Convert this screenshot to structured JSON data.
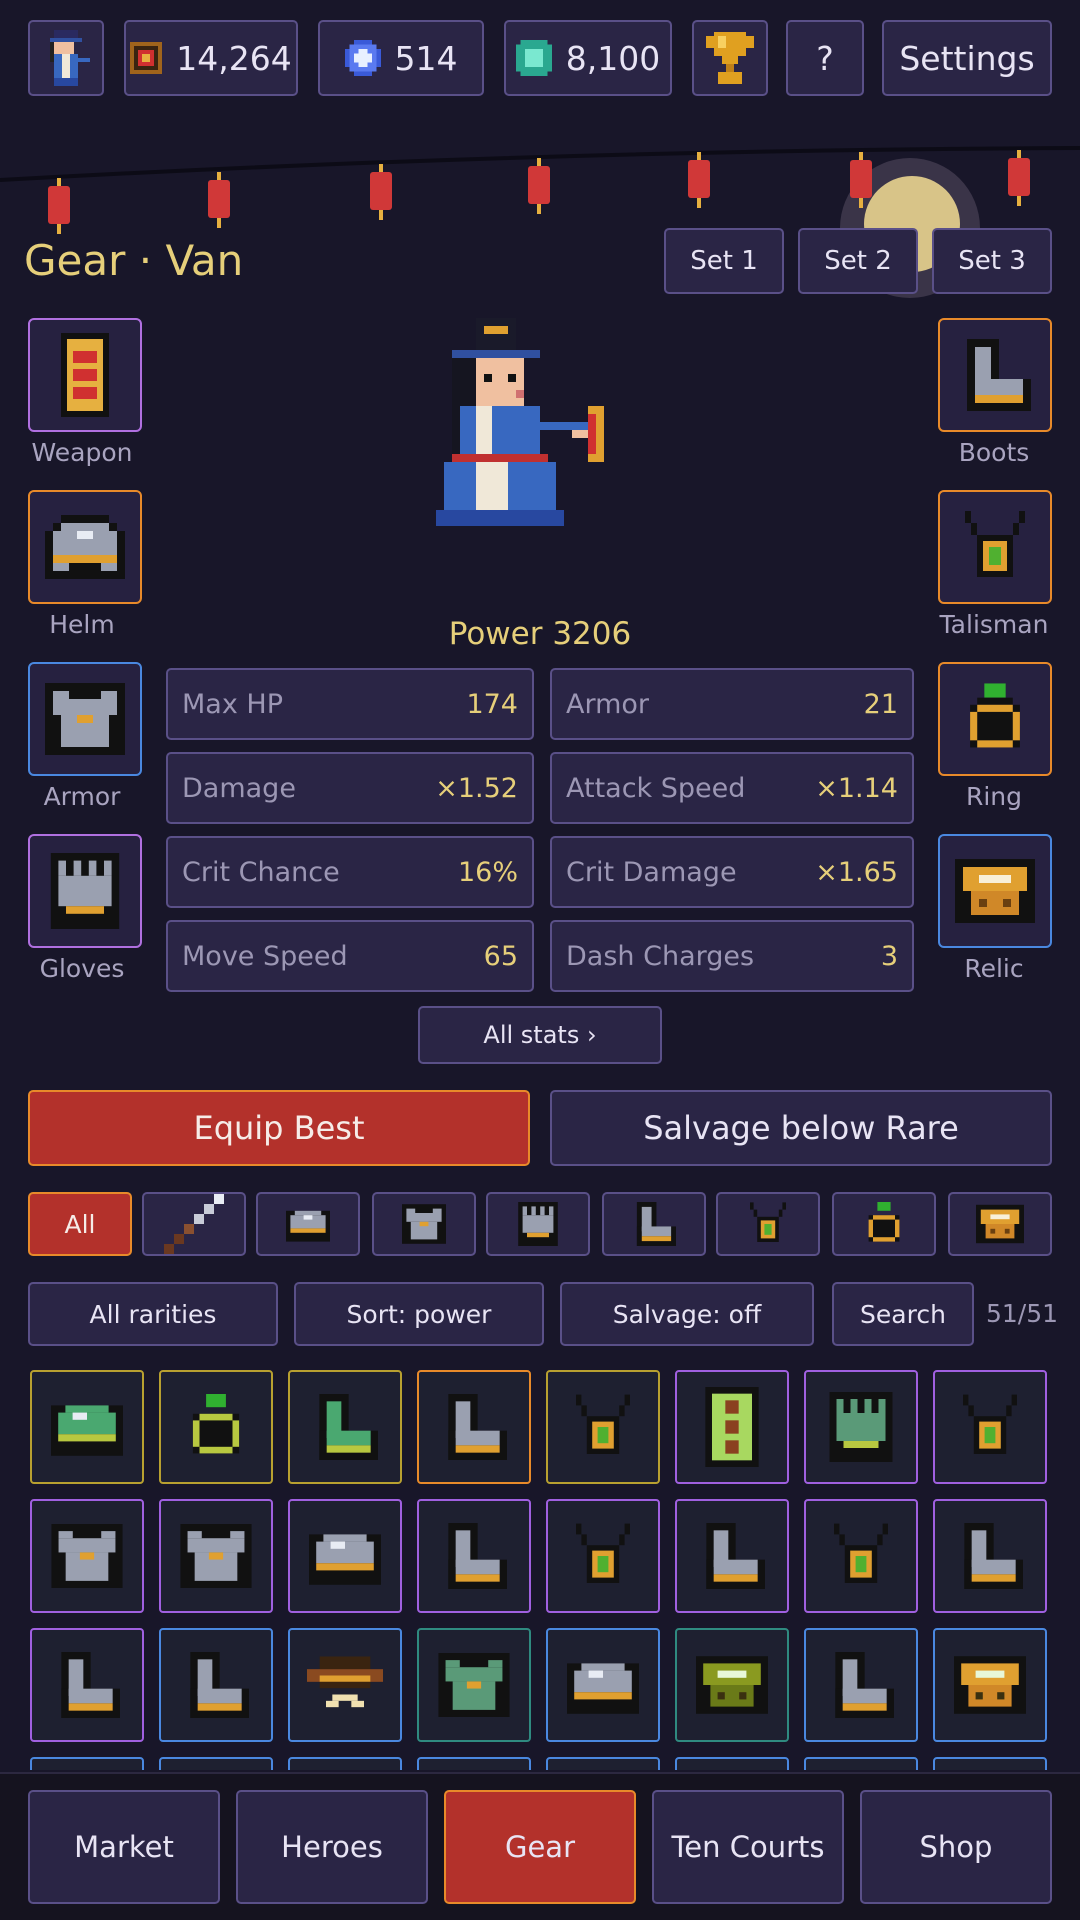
{
  "topbar": {
    "gold": "14,264",
    "essence": "514",
    "gems": "8,100",
    "help_label": "?",
    "settings_label": "Settings"
  },
  "header": {
    "title": "Gear · Van",
    "sets": [
      "Set 1",
      "Set 2",
      "Set 3"
    ]
  },
  "slots": {
    "left": [
      {
        "label": "Weapon",
        "icon": "scroll-icon",
        "rarity": "epic"
      },
      {
        "label": "Helm",
        "icon": "helm-icon",
        "rarity": "legendary"
      },
      {
        "label": "Armor",
        "icon": "armor-icon",
        "rarity": "rare"
      },
      {
        "label": "Gloves",
        "icon": "gloves-icon",
        "rarity": "epic"
      }
    ],
    "right": [
      {
        "label": "Boots",
        "icon": "boots-icon",
        "rarity": "legendary"
      },
      {
        "label": "Talisman",
        "icon": "talisman-icon",
        "rarity": "legendary"
      },
      {
        "label": "Ring",
        "icon": "ring-icon",
        "rarity": "legendary"
      },
      {
        "label": "Relic",
        "icon": "relic-icon",
        "rarity": "rare"
      }
    ]
  },
  "power_label": "Power 3206",
  "stats": [
    {
      "name": "Max HP",
      "value": "174"
    },
    {
      "name": "Armor",
      "value": "21"
    },
    {
      "name": "Damage",
      "value": "×1.52"
    },
    {
      "name": "Attack Speed",
      "value": "×1.14"
    },
    {
      "name": "Crit Chance",
      "value": "16%"
    },
    {
      "name": "Crit Damage",
      "value": "×1.65"
    },
    {
      "name": "Move Speed",
      "value": "65"
    },
    {
      "name": "Dash Charges",
      "value": "3"
    }
  ],
  "all_stats_label": "All stats ›",
  "actions": {
    "equip_best": "Equip Best",
    "salvage": "Salvage below Rare"
  },
  "filters": {
    "all_label": "All",
    "icons": [
      "sword-icon",
      "helm-icon",
      "armor-icon",
      "gloves-icon",
      "boots-icon",
      "talisman-icon",
      "ring-icon",
      "relic-icon"
    ]
  },
  "tools": {
    "rarity": "All rarities",
    "sort": "Sort: power",
    "salvage": "Salvage: off",
    "search": "Search",
    "count": "51/51"
  },
  "inventory": [
    {
      "icon": "helm-icon",
      "rarity": "mythic"
    },
    {
      "icon": "ring-icon",
      "rarity": "mythic"
    },
    {
      "icon": "boots-icon",
      "rarity": "mythic"
    },
    {
      "icon": "boots-icon",
      "rarity": "legendary"
    },
    {
      "icon": "talisman-icon",
      "rarity": "mythic"
    },
    {
      "icon": "scroll-icon",
      "rarity": "epic"
    },
    {
      "icon": "gloves-icon",
      "rarity": "epic"
    },
    {
      "icon": "talisman-icon",
      "rarity": "epic"
    },
    {
      "icon": "armor-icon",
      "rarity": "epic"
    },
    {
      "icon": "armor-icon",
      "rarity": "epic"
    },
    {
      "icon": "helm-icon",
      "rarity": "epic"
    },
    {
      "icon": "boots-icon",
      "rarity": "epic"
    },
    {
      "icon": "talisman-icon",
      "rarity": "epic"
    },
    {
      "icon": "boots-icon",
      "rarity": "epic"
    },
    {
      "icon": "talisman-icon",
      "rarity": "epic"
    },
    {
      "icon": "boots-icon",
      "rarity": "epic"
    },
    {
      "icon": "boots-icon",
      "rarity": "epic"
    },
    {
      "icon": "boots-icon",
      "rarity": "rare"
    },
    {
      "icon": "saucer-icon",
      "rarity": "rare"
    },
    {
      "icon": "armor-icon",
      "rarity": "uncommon"
    },
    {
      "icon": "helm-icon",
      "rarity": "rare"
    },
    {
      "icon": "relic-icon",
      "rarity": "uncommon"
    },
    {
      "icon": "boots-icon",
      "rarity": "rare"
    },
    {
      "icon": "relic-icon",
      "rarity": "rare"
    }
  ],
  "nav": [
    "Market",
    "Heroes",
    "Gear",
    "Ten Courts",
    "Shop"
  ],
  "colors": {
    "background": "#181629",
    "panel": "#2a2545",
    "accent_red": "#b3312b",
    "gold_text": "#e6cf7a",
    "epic": "#a060e0",
    "legendary": "#e88a2a",
    "rare": "#4a88e0",
    "mythic": "#b8a030",
    "uncommon": "#2f8a80"
  }
}
